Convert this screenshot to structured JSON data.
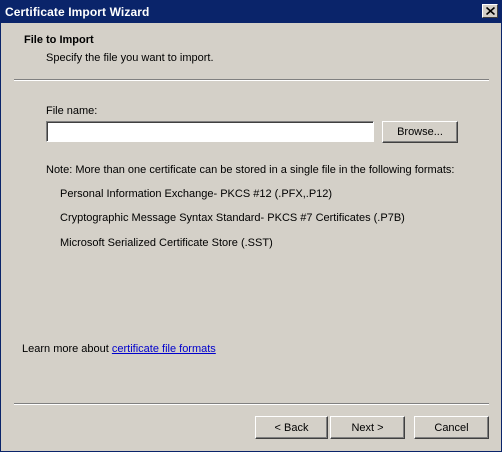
{
  "window": {
    "title": "Certificate Import Wizard"
  },
  "header": {
    "title": "File to Import",
    "subtitle": "Specify the file you want to import."
  },
  "file_name": {
    "label": "File name:",
    "value": "",
    "browse_label": "Browse..."
  },
  "note": {
    "text": "Note:  More than one certificate can be stored in a single file in the following formats:",
    "formats": [
      "Personal Information Exchange- PKCS #12 (.PFX,.P12)",
      "Cryptographic Message Syntax Standard- PKCS #7 Certificates (.P7B)",
      "Microsoft Serialized Certificate Store (.SST)"
    ]
  },
  "learn_more": {
    "prefix": "Learn more about ",
    "link_text": "certificate file formats"
  },
  "footer": {
    "back_label": "< Back",
    "next_label": "Next >",
    "cancel_label": "Cancel"
  },
  "colors": {
    "titlebar": "#0a246a",
    "dialog_bg": "#d4d0c8",
    "link": "#0000cc"
  },
  "icons": {
    "close": "close-icon"
  }
}
